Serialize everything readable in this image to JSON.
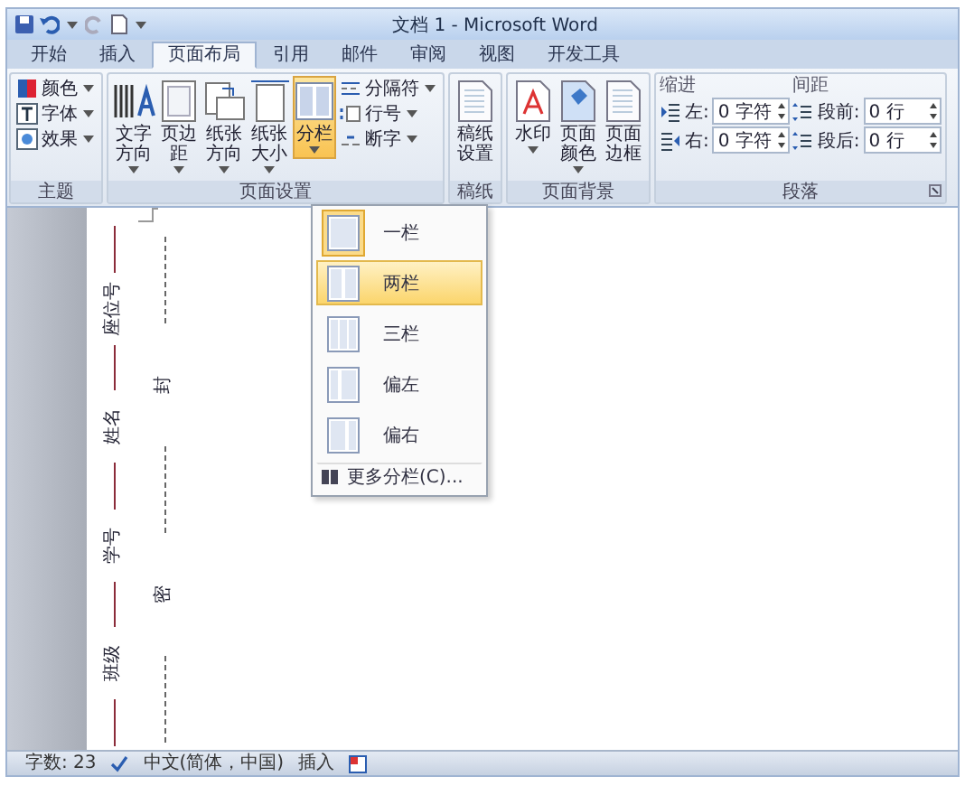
{
  "window": {
    "title": "文档 1 - Microsoft Word"
  },
  "tabs": [
    {
      "label": "开始",
      "selected": false
    },
    {
      "label": "插入",
      "selected": false
    },
    {
      "label": "页面布局",
      "selected": true
    },
    {
      "label": "引用",
      "selected": false
    },
    {
      "label": "邮件",
      "selected": false
    },
    {
      "label": "审阅",
      "selected": false
    },
    {
      "label": "视图",
      "selected": false
    },
    {
      "label": "开发工具",
      "selected": false
    }
  ],
  "ribbon_groups": [
    {
      "title": "主题",
      "items": [
        {
          "kind": "small",
          "label": "颜色"
        },
        {
          "kind": "small",
          "label": "字体"
        },
        {
          "kind": "small",
          "label": "效果"
        }
      ]
    },
    {
      "title": "页面设置",
      "items": [
        {
          "kind": "large",
          "label": "文字方向",
          "active": false
        },
        {
          "kind": "large",
          "label": "页边距",
          "active": false
        },
        {
          "kind": "large",
          "label": "纸张方向",
          "active": false
        },
        {
          "kind": "large",
          "label": "纸张大小",
          "active": false
        },
        {
          "kind": "large",
          "label": "分栏",
          "active": true
        },
        {
          "kind": "stack",
          "items": [
            {
              "label": "分隔符"
            },
            {
              "label": "行号"
            },
            {
              "label": "断字"
            }
          ]
        }
      ]
    },
    {
      "title": "稿纸",
      "items": [
        {
          "kind": "large",
          "label": "稿纸设置",
          "active": false
        }
      ]
    },
    {
      "title": "页面背景",
      "items": [
        {
          "kind": "large",
          "label": "水印",
          "active": false
        },
        {
          "kind": "large",
          "label": "页面颜色",
          "active": false
        },
        {
          "kind": "large",
          "label": "页面边框",
          "active": false
        }
      ]
    },
    {
      "title": "段落",
      "items": [
        {
          "kind": "spinners",
          "heading": "缩进",
          "rows": [
            {
              "label": "左:",
              "value": "0 字符"
            },
            {
              "label": "右:",
              "value": "0 字符"
            }
          ]
        },
        {
          "kind": "spinners",
          "heading": "间距",
          "rows": [
            {
              "label": "段前:",
              "value": "0 行"
            },
            {
              "label": "段后:",
              "value": "0 行"
            }
          ]
        }
      ]
    }
  ],
  "columns_menu": {
    "items": [
      {
        "label": "一栏",
        "selected": false,
        "checked": true
      },
      {
        "label": "两栏",
        "selected": true,
        "checked": false
      },
      {
        "label": "三栏",
        "selected": false,
        "checked": false
      },
      {
        "label": "偏左",
        "selected": false,
        "checked": false
      },
      {
        "label": "偏右",
        "selected": false,
        "checked": false
      }
    ],
    "more": "更多分栏(C)..."
  },
  "document": {
    "fields": [
      "座位号",
      "姓名",
      "学号",
      "班级"
    ],
    "seal_marks": [
      "封",
      "密"
    ]
  },
  "status_bar": [
    "字数: 23",
    "中文(简体，中国)",
    "插入"
  ]
}
